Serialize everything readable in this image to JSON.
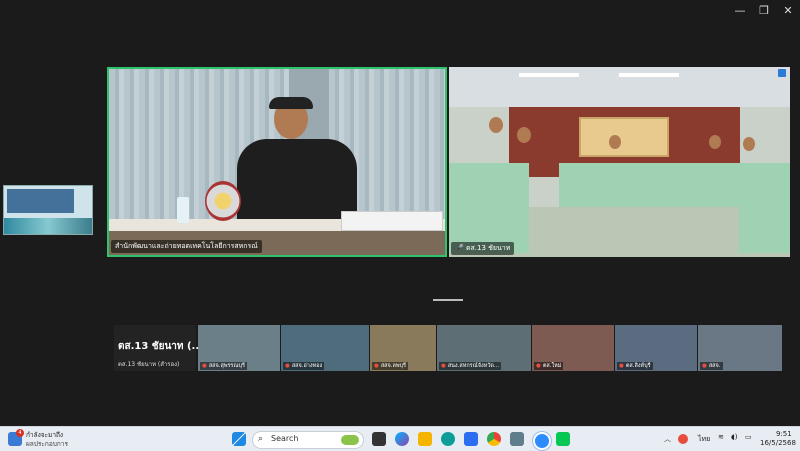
{
  "window": {
    "controls": [
      "—",
      "❐",
      "✕"
    ]
  },
  "main_tiles": {
    "host_label": "สำนักพัฒนาและถ่ายทอดเทคโนโลยีการสหกรณ์",
    "room_label": "ตส.13 ชัยนาท"
  },
  "gallery": {
    "featured_name": "ตส.13 ชัยนาท (...",
    "featured_sub": "ตส.13 ชัยนาท (สำรอง)",
    "thumbs": [
      {
        "label": "สสจ.สุพรรณบุรี",
        "color": "#6b7f89"
      },
      {
        "label": "สสจ.อ่างทอง",
        "color": "#4f6c7d"
      },
      {
        "label": "สสจ.ลพบุรี",
        "color": "#8a7a5c"
      },
      {
        "label": "สนง.สหกรณ์จังหวัด...",
        "color": "#5d6e74"
      },
      {
        "label": "ตส.ใหม่",
        "color": "#7d5b52"
      },
      {
        "label": "ตส.สิงห์บุรี",
        "color": "#5b6b80"
      },
      {
        "label": "สสจ.",
        "color": "#6a7784"
      }
    ]
  },
  "taskbar": {
    "weather_line1": "กำลังจะมาถึง",
    "weather_line2": "ผลประกอบการ",
    "badge": "4",
    "search_label": "Search",
    "lang": "ไทย",
    "time": "9:51",
    "date": "16/5/2568"
  }
}
